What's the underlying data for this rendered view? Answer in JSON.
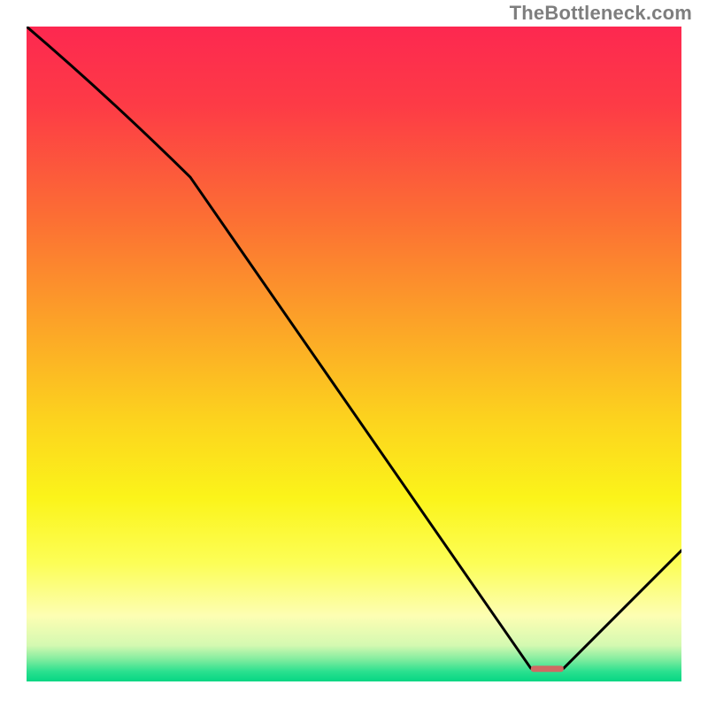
{
  "attribution": "TheBottleneck.com",
  "chart_data": {
    "type": "line",
    "title": "",
    "xlabel": "",
    "ylabel": "",
    "xlim": [
      0,
      100
    ],
    "ylim": [
      0,
      100
    ],
    "series": [
      {
        "name": "curve",
        "x": [
          0,
          25,
          77,
          82,
          100
        ],
        "values": [
          100,
          77,
          2,
          2,
          20
        ]
      }
    ],
    "marker": {
      "name": "highlight-segment",
      "x_start": 77,
      "x_end": 82,
      "y": 2,
      "color": "#cf6a63"
    },
    "background_gradient": {
      "stops": [
        {
          "offset": 0.0,
          "color": "#fd2850"
        },
        {
          "offset": 0.12,
          "color": "#fd3b46"
        },
        {
          "offset": 0.3,
          "color": "#fc7133"
        },
        {
          "offset": 0.45,
          "color": "#fca228"
        },
        {
          "offset": 0.6,
          "color": "#fcd31e"
        },
        {
          "offset": 0.72,
          "color": "#fbf41a"
        },
        {
          "offset": 0.82,
          "color": "#fcfe57"
        },
        {
          "offset": 0.9,
          "color": "#fdfeb3"
        },
        {
          "offset": 0.945,
          "color": "#d4f9b1"
        },
        {
          "offset": 0.965,
          "color": "#87eda0"
        },
        {
          "offset": 0.985,
          "color": "#2ae08f"
        },
        {
          "offset": 1.0,
          "color": "#06d683"
        }
      ]
    }
  }
}
